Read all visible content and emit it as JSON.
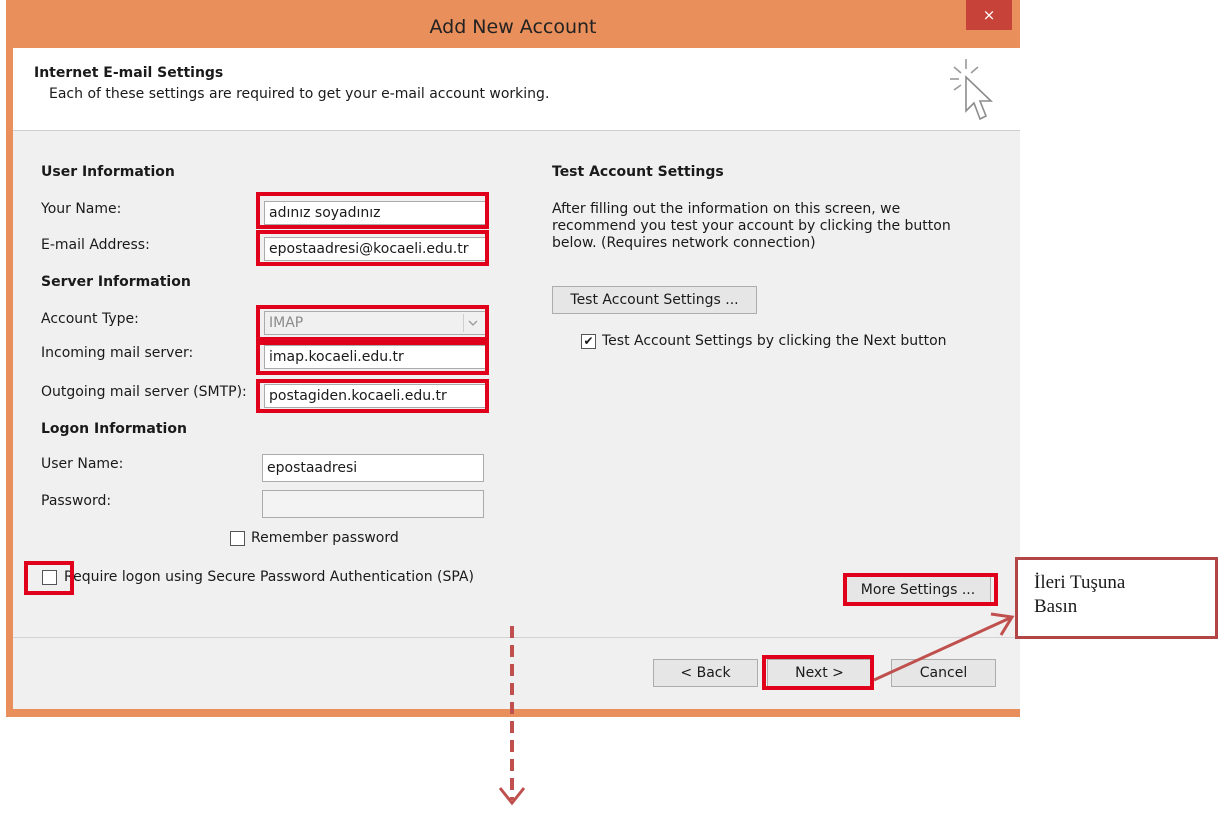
{
  "window": {
    "title": "Add New Account",
    "close_glyph": "×"
  },
  "header": {
    "title": "Internet E-mail Settings",
    "subtitle": "Each of these settings are required to get your e-mail account working.",
    "icon": "cursor-wand-icon"
  },
  "user_info": {
    "heading": "User Information",
    "name_label": "Your Name:",
    "name_value": "adınız soyadınız",
    "email_label": "E-mail Address:",
    "email_value": "epostaadresi@kocaeli.edu.tr"
  },
  "server_info": {
    "heading": "Server Information",
    "account_type_label": "Account Type:",
    "account_type_value": "IMAP",
    "incoming_label": "Incoming mail server:",
    "incoming_value": "imap.kocaeli.edu.tr",
    "outgoing_label": "Outgoing mail server (SMTP):",
    "outgoing_value": "postagiden.kocaeli.edu.tr"
  },
  "logon_info": {
    "heading": "Logon Information",
    "username_label": "User Name:",
    "username_value": "epostaadresi",
    "password_label": "Password:",
    "password_value": "",
    "remember_label": "Remember password",
    "remember_checked": false,
    "spa_label": "Require logon using Secure Password Authentication (SPA)",
    "spa_checked": false
  },
  "test": {
    "heading": "Test Account Settings",
    "description": [
      "After filling out the information on this screen, we",
      "recommend you test your account by clicking the button",
      "below. (Requires network connection)"
    ],
    "button": "Test Account Settings ...",
    "checkbox_label": "Test Account Settings by clicking the Next button",
    "checkbox_checked": true,
    "check_glyph": "✔"
  },
  "more_settings_button": "More Settings ...",
  "footer": {
    "back": "< Back",
    "next": "Next >",
    "cancel": "Cancel"
  },
  "annotation": {
    "callout_lines": [
      "İleri Tuşuna",
      "Basın"
    ],
    "highlight_color": "#e0001b",
    "arrow_color": "#c0504d"
  },
  "colors": {
    "titlebar": "#e98f5b",
    "close": "#c7433a",
    "panel": "#f0f0f0"
  }
}
